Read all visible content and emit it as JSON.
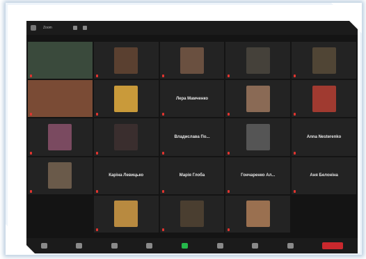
{
  "window": {
    "title": "Zoom"
  },
  "colors": {
    "active_border": "#b8d94a",
    "mic_muted": "#e0342f",
    "end": "#c9282d"
  },
  "tiles": [
    {
      "type": "photo",
      "label": "",
      "photo": "#3a4a3c",
      "active": false
    },
    {
      "type": "photo",
      "label": "",
      "photo": "#5a4030",
      "active": false
    },
    {
      "type": "photo",
      "label": "",
      "photo": "#6a5040",
      "active": false
    },
    {
      "type": "photo",
      "label": "",
      "photo": "#45413a",
      "active": false
    },
    {
      "type": "photo",
      "label": "",
      "photo": "#504535",
      "active": false
    },
    {
      "type": "photo",
      "label": "",
      "photo": "#7a4b35",
      "active": true
    },
    {
      "type": "photo",
      "label": "",
      "photo": "#c99a3a",
      "active": false
    },
    {
      "type": "name",
      "label": "",
      "big": "Лера Мамченко",
      "active": false
    },
    {
      "type": "photo",
      "label": "",
      "photo": "#8a6a55",
      "active": false
    },
    {
      "type": "photo",
      "label": "",
      "photo": "#a03a30",
      "active": false
    },
    {
      "type": "photo",
      "label": "",
      "photo": "#7a4a60",
      "active": false
    },
    {
      "type": "photo",
      "label": "",
      "photo": "#3a2e2e",
      "active": false
    },
    {
      "type": "name",
      "label": "",
      "big": "Владислава По...",
      "active": false
    },
    {
      "type": "photo",
      "label": "",
      "photo": "#555555",
      "active": false
    },
    {
      "type": "name",
      "label": "",
      "big": "Anna Nesterenko",
      "active": false
    },
    {
      "type": "photo",
      "label": "",
      "photo": "#6a5a4a",
      "active": false
    },
    {
      "type": "name",
      "label": "",
      "big": "Каріна Левицько",
      "active": false
    },
    {
      "type": "name",
      "label": "",
      "big": "Марія Глоба",
      "active": false
    },
    {
      "type": "name",
      "label": "",
      "big": "Гончаренко Ал...",
      "active": false
    },
    {
      "type": "name",
      "label": "",
      "big": "Аня Белоніна",
      "active": false
    },
    {
      "type": "empty"
    },
    {
      "type": "photo",
      "label": "",
      "photo": "#b88a40",
      "active": false
    },
    {
      "type": "photo",
      "label": "",
      "photo": "#4a3e30",
      "active": false
    },
    {
      "type": "photo",
      "label": "",
      "photo": "#9a7050",
      "active": false
    },
    {
      "type": "empty"
    }
  ],
  "toolbar": [
    "mute",
    "video",
    "participants",
    "chat",
    "share",
    "record",
    "reactions",
    "more"
  ],
  "end_label": ""
}
